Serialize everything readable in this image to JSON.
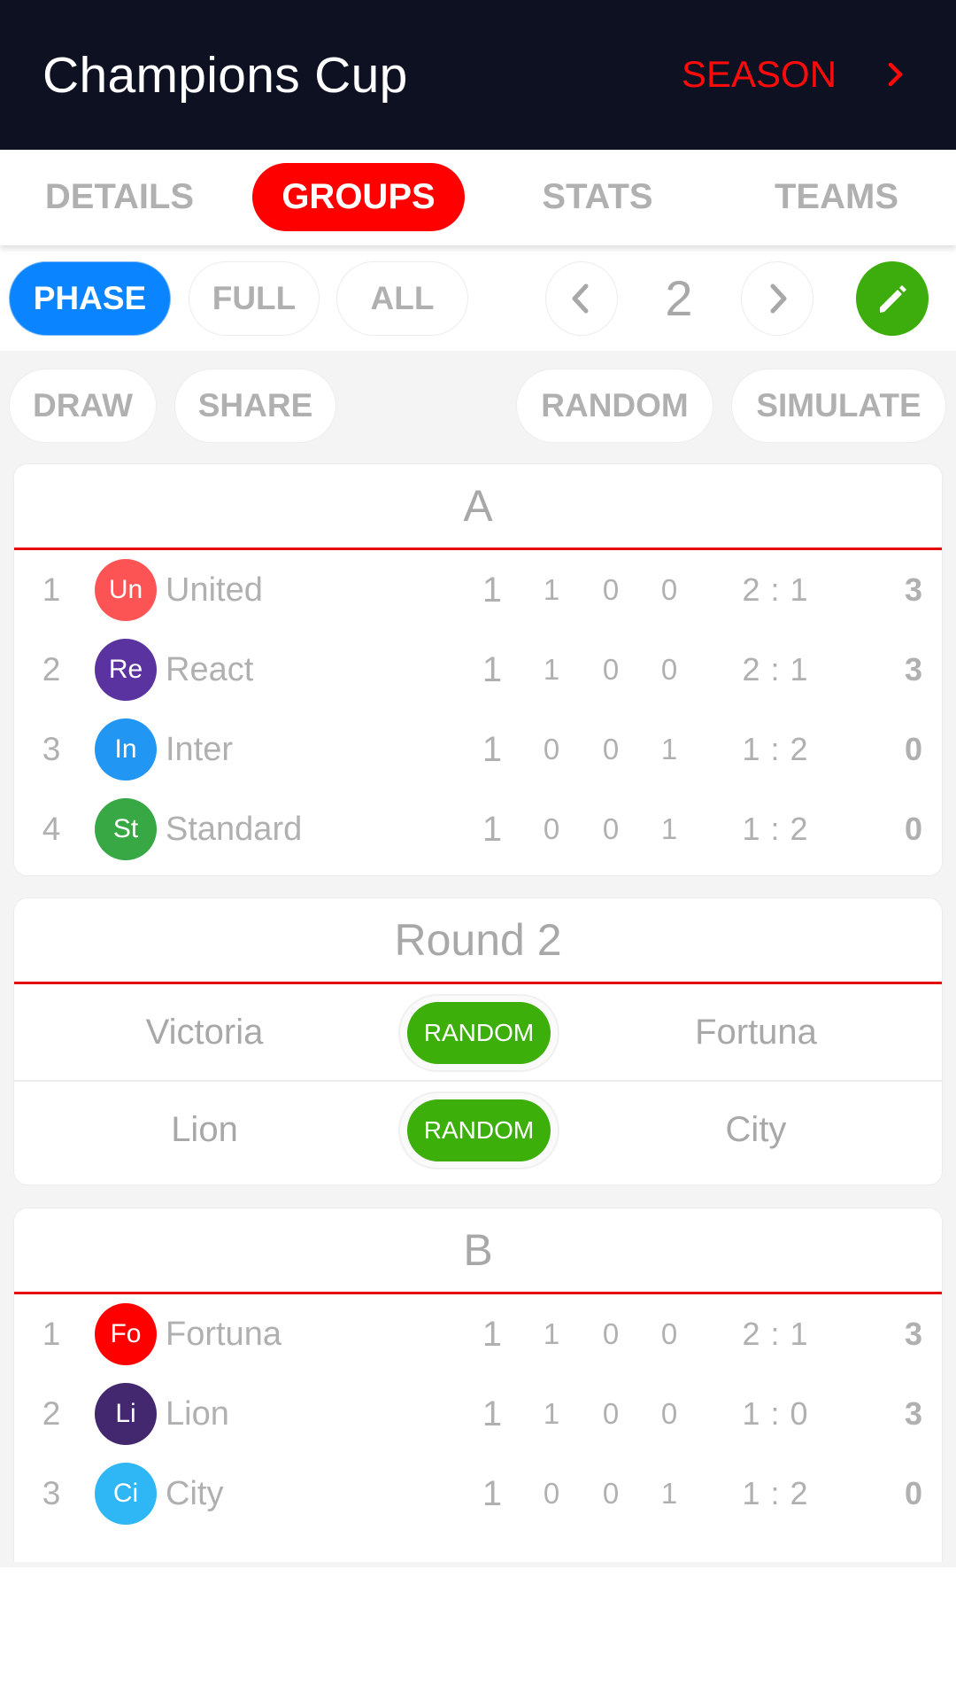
{
  "header": {
    "title": "Champions Cup",
    "season_label": "SEASON",
    "season_icon": "chevron-right-icon"
  },
  "tabs": [
    {
      "label": "DETAILS",
      "active": false
    },
    {
      "label": "GROUPS",
      "active": true
    },
    {
      "label": "STATS",
      "active": false
    },
    {
      "label": "TEAMS",
      "active": false
    }
  ],
  "filters": {
    "phase": "PHASE",
    "full": "FULL",
    "all": "ALL",
    "active": "PHASE",
    "page": "2",
    "prev_icon": "chevron-left-icon",
    "next_icon": "chevron-right-icon",
    "edit_icon": "pencil-icon"
  },
  "actions": {
    "draw": "DRAW",
    "share": "SHARE",
    "random": "RANDOM",
    "simulate": "SIMULATE"
  },
  "colors": {
    "header_bg": "#0d1122",
    "accent_red": "#ff0000",
    "phase_blue": "#0a84ff",
    "action_green": "#3caf0a"
  },
  "groups": [
    {
      "name": "A",
      "rows": [
        {
          "pos": "1",
          "abbr": "Un",
          "team": "United",
          "color": "#fc5454",
          "played": "1",
          "won": "1",
          "drawn": "0",
          "lost": "0",
          "goals": "2 : 1",
          "points": "3"
        },
        {
          "pos": "2",
          "abbr": "Re",
          "team": "React",
          "color": "#5b33a0",
          "played": "1",
          "won": "1",
          "drawn": "0",
          "lost": "0",
          "goals": "2 : 1",
          "points": "3"
        },
        {
          "pos": "3",
          "abbr": "In",
          "team": "Inter",
          "color": "#2196f3",
          "played": "1",
          "won": "0",
          "drawn": "0",
          "lost": "1",
          "goals": "1 : 2",
          "points": "0"
        },
        {
          "pos": "4",
          "abbr": "St",
          "team": "Standard",
          "color": "#37a844",
          "played": "1",
          "won": "0",
          "drawn": "0",
          "lost": "1",
          "goals": "1 : 2",
          "points": "0"
        }
      ]
    },
    {
      "name": "B",
      "rows": [
        {
          "pos": "1",
          "abbr": "Fo",
          "team": "Fortuna",
          "color": "#ff0000",
          "played": "1",
          "won": "1",
          "drawn": "0",
          "lost": "0",
          "goals": "2 : 1",
          "points": "3"
        },
        {
          "pos": "2",
          "abbr": "Li",
          "team": "Lion",
          "color": "#432870",
          "played": "1",
          "won": "1",
          "drawn": "0",
          "lost": "0",
          "goals": "1 : 0",
          "points": "3"
        },
        {
          "pos": "3",
          "abbr": "Ci",
          "team": "City",
          "color": "#2fb6f4",
          "played": "1",
          "won": "0",
          "drawn": "0",
          "lost": "1",
          "goals": "1 : 2",
          "points": "0"
        }
      ]
    }
  ],
  "round": {
    "title": "Round 2",
    "matches": [
      {
        "home": "Victoria",
        "away": "Fortuna",
        "button": "RANDOM"
      },
      {
        "home": "Lion",
        "away": "City",
        "button": "RANDOM"
      }
    ]
  }
}
